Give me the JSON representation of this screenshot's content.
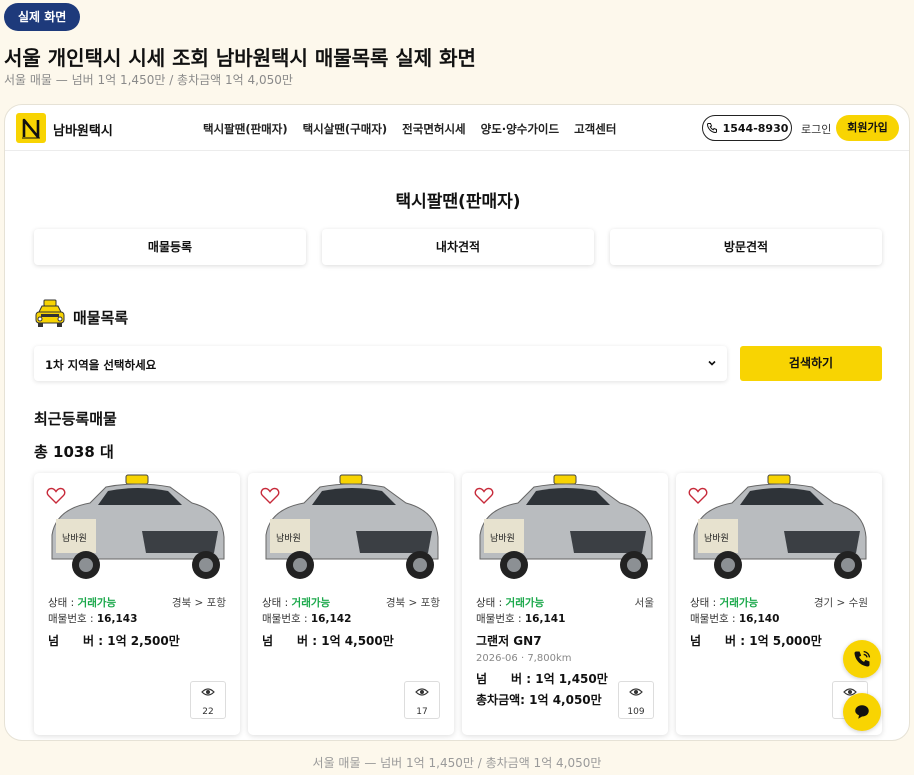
{
  "badge": "실제 화면",
  "page_title": "서울 개인택시 시세 조회 남바원택시 매물목록 실제 화면",
  "page_subtitle": "서울 매물 — 넘버 1억 1,450만 / 총차금액 1억 4,050만",
  "caption": "서울 매물 — 넘버 1억 1,450만 / 총차금액 1억 4,050만",
  "header": {
    "brand": "남바원택시",
    "nav": [
      "택시팔땐(판매자)",
      "택시살땐(구매자)",
      "전국면허시세",
      "양도·양수가이드",
      "고객센터"
    ],
    "phone": "1544-8930",
    "login": "로그인",
    "signup": "회원가입"
  },
  "main": {
    "section_title": "택시팔땐(판매자)",
    "actions": [
      "매물등록",
      "내차견적",
      "방문견적"
    ],
    "list_heading": "매물목록",
    "region_select": "1차 지역을 선택하세요",
    "search_button": "검색하기",
    "recent_title": "최근등록매물",
    "total": "총 1038 대"
  },
  "cards": [
    {
      "status_label": "상태 :",
      "status": "거래가능",
      "region": "경북 > 포항",
      "no_label": "매물번호 :",
      "no": "16,143",
      "number_price": "넘　　버 : 1억 2,500만",
      "views": "22"
    },
    {
      "status_label": "상태 :",
      "status": "거래가능",
      "region": "경북 > 포항",
      "no_label": "매물번호 :",
      "no": "16,142",
      "number_price": "넘　　버 : 1억 4,500만"
    },
    {
      "status_label": "상태 :",
      "status": "거래가능",
      "region": "서울",
      "no_label": "매물번호 :",
      "no": "16,141",
      "model": "그랜저 GN7",
      "meta": "2026-06 · 7,800km",
      "number_price": "넘　　버 : 1억 1,450만",
      "total_price": "총차금액: 1억 4,050만",
      "views": "109"
    },
    {
      "status_label": "상태 :",
      "status": "거래가능",
      "region": "경기 > 수원",
      "no_label": "매물번호 :",
      "no": "16,140",
      "number_price": "넘　　버 : 1억 5,000만"
    }
  ],
  "views_17": "17",
  "colors": {
    "accent": "#f8d402",
    "status": "#1aa84a",
    "badge": "#1e3a7b"
  },
  "icons": [
    "logo-n-icon",
    "phone-icon",
    "taxi-icon",
    "chevron-down-icon",
    "heart-icon",
    "eye-icon",
    "phone-call-icon",
    "chat-icon"
  ]
}
